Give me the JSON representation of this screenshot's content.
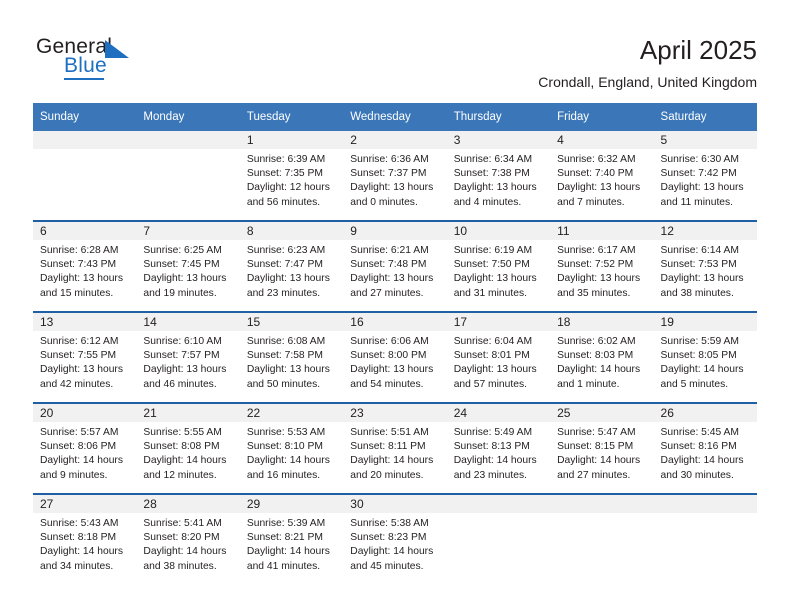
{
  "brand": {
    "name_top": "General",
    "name_bottom": "Blue",
    "logo_icon": "triangle-icon",
    "accent_color": "#1f6fc0"
  },
  "header": {
    "title": "April 2025",
    "subtitle": "Crondall, England, United Kingdom"
  },
  "theme": {
    "header_row_bg": "#3a76b8",
    "week_divider": "#1f5fa4",
    "daynum_bg": "#f1f1f1",
    "text": "#231f20"
  },
  "calendar": {
    "weekday_headers": [
      "Sunday",
      "Monday",
      "Tuesday",
      "Wednesday",
      "Thursday",
      "Friday",
      "Saturday"
    ],
    "labels": {
      "sunrise": "Sunrise:",
      "sunset": "Sunset:",
      "daylight": "Daylight:"
    },
    "weeks": [
      [
        {
          "day": "",
          "sunrise": "",
          "sunset": "",
          "daylight": ""
        },
        {
          "day": "",
          "sunrise": "",
          "sunset": "",
          "daylight": ""
        },
        {
          "day": "1",
          "sunrise": "Sunrise: 6:39 AM",
          "sunset": "Sunset: 7:35 PM",
          "daylight": "Daylight: 12 hours and 56 minutes."
        },
        {
          "day": "2",
          "sunrise": "Sunrise: 6:36 AM",
          "sunset": "Sunset: 7:37 PM",
          "daylight": "Daylight: 13 hours and 0 minutes."
        },
        {
          "day": "3",
          "sunrise": "Sunrise: 6:34 AM",
          "sunset": "Sunset: 7:38 PM",
          "daylight": "Daylight: 13 hours and 4 minutes."
        },
        {
          "day": "4",
          "sunrise": "Sunrise: 6:32 AM",
          "sunset": "Sunset: 7:40 PM",
          "daylight": "Daylight: 13 hours and 7 minutes."
        },
        {
          "day": "5",
          "sunrise": "Sunrise: 6:30 AM",
          "sunset": "Sunset: 7:42 PM",
          "daylight": "Daylight: 13 hours and 11 minutes."
        }
      ],
      [
        {
          "day": "6",
          "sunrise": "Sunrise: 6:28 AM",
          "sunset": "Sunset: 7:43 PM",
          "daylight": "Daylight: 13 hours and 15 minutes."
        },
        {
          "day": "7",
          "sunrise": "Sunrise: 6:25 AM",
          "sunset": "Sunset: 7:45 PM",
          "daylight": "Daylight: 13 hours and 19 minutes."
        },
        {
          "day": "8",
          "sunrise": "Sunrise: 6:23 AM",
          "sunset": "Sunset: 7:47 PM",
          "daylight": "Daylight: 13 hours and 23 minutes."
        },
        {
          "day": "9",
          "sunrise": "Sunrise: 6:21 AM",
          "sunset": "Sunset: 7:48 PM",
          "daylight": "Daylight: 13 hours and 27 minutes."
        },
        {
          "day": "10",
          "sunrise": "Sunrise: 6:19 AM",
          "sunset": "Sunset: 7:50 PM",
          "daylight": "Daylight: 13 hours and 31 minutes."
        },
        {
          "day": "11",
          "sunrise": "Sunrise: 6:17 AM",
          "sunset": "Sunset: 7:52 PM",
          "daylight": "Daylight: 13 hours and 35 minutes."
        },
        {
          "day": "12",
          "sunrise": "Sunrise: 6:14 AM",
          "sunset": "Sunset: 7:53 PM",
          "daylight": "Daylight: 13 hours and 38 minutes."
        }
      ],
      [
        {
          "day": "13",
          "sunrise": "Sunrise: 6:12 AM",
          "sunset": "Sunset: 7:55 PM",
          "daylight": "Daylight: 13 hours and 42 minutes."
        },
        {
          "day": "14",
          "sunrise": "Sunrise: 6:10 AM",
          "sunset": "Sunset: 7:57 PM",
          "daylight": "Daylight: 13 hours and 46 minutes."
        },
        {
          "day": "15",
          "sunrise": "Sunrise: 6:08 AM",
          "sunset": "Sunset: 7:58 PM",
          "daylight": "Daylight: 13 hours and 50 minutes."
        },
        {
          "day": "16",
          "sunrise": "Sunrise: 6:06 AM",
          "sunset": "Sunset: 8:00 PM",
          "daylight": "Daylight: 13 hours and 54 minutes."
        },
        {
          "day": "17",
          "sunrise": "Sunrise: 6:04 AM",
          "sunset": "Sunset: 8:01 PM",
          "daylight": "Daylight: 13 hours and 57 minutes."
        },
        {
          "day": "18",
          "sunrise": "Sunrise: 6:02 AM",
          "sunset": "Sunset: 8:03 PM",
          "daylight": "Daylight: 14 hours and 1 minute."
        },
        {
          "day": "19",
          "sunrise": "Sunrise: 5:59 AM",
          "sunset": "Sunset: 8:05 PM",
          "daylight": "Daylight: 14 hours and 5 minutes."
        }
      ],
      [
        {
          "day": "20",
          "sunrise": "Sunrise: 5:57 AM",
          "sunset": "Sunset: 8:06 PM",
          "daylight": "Daylight: 14 hours and 9 minutes."
        },
        {
          "day": "21",
          "sunrise": "Sunrise: 5:55 AM",
          "sunset": "Sunset: 8:08 PM",
          "daylight": "Daylight: 14 hours and 12 minutes."
        },
        {
          "day": "22",
          "sunrise": "Sunrise: 5:53 AM",
          "sunset": "Sunset: 8:10 PM",
          "daylight": "Daylight: 14 hours and 16 minutes."
        },
        {
          "day": "23",
          "sunrise": "Sunrise: 5:51 AM",
          "sunset": "Sunset: 8:11 PM",
          "daylight": "Daylight: 14 hours and 20 minutes."
        },
        {
          "day": "24",
          "sunrise": "Sunrise: 5:49 AM",
          "sunset": "Sunset: 8:13 PM",
          "daylight": "Daylight: 14 hours and 23 minutes."
        },
        {
          "day": "25",
          "sunrise": "Sunrise: 5:47 AM",
          "sunset": "Sunset: 8:15 PM",
          "daylight": "Daylight: 14 hours and 27 minutes."
        },
        {
          "day": "26",
          "sunrise": "Sunrise: 5:45 AM",
          "sunset": "Sunset: 8:16 PM",
          "daylight": "Daylight: 14 hours and 30 minutes."
        }
      ],
      [
        {
          "day": "27",
          "sunrise": "Sunrise: 5:43 AM",
          "sunset": "Sunset: 8:18 PM",
          "daylight": "Daylight: 14 hours and 34 minutes."
        },
        {
          "day": "28",
          "sunrise": "Sunrise: 5:41 AM",
          "sunset": "Sunset: 8:20 PM",
          "daylight": "Daylight: 14 hours and 38 minutes."
        },
        {
          "day": "29",
          "sunrise": "Sunrise: 5:39 AM",
          "sunset": "Sunset: 8:21 PM",
          "daylight": "Daylight: 14 hours and 41 minutes."
        },
        {
          "day": "30",
          "sunrise": "Sunrise: 5:38 AM",
          "sunset": "Sunset: 8:23 PM",
          "daylight": "Daylight: 14 hours and 45 minutes."
        },
        {
          "day": "",
          "sunrise": "",
          "sunset": "",
          "daylight": ""
        },
        {
          "day": "",
          "sunrise": "",
          "sunset": "",
          "daylight": ""
        },
        {
          "day": "",
          "sunrise": "",
          "sunset": "",
          "daylight": ""
        }
      ]
    ]
  }
}
